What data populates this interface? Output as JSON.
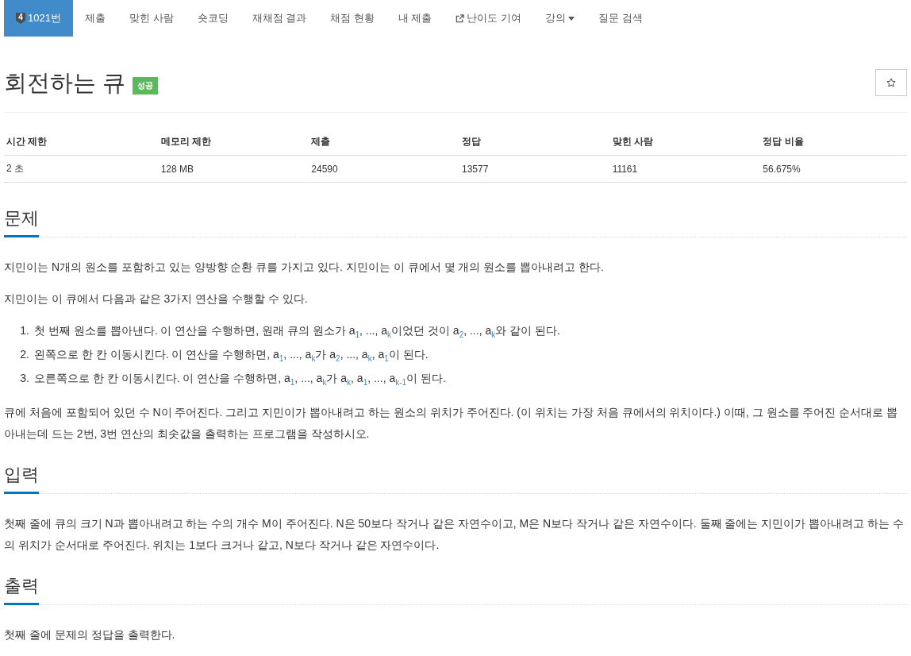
{
  "nav": {
    "items": [
      {
        "label": "1021번",
        "badge": "4",
        "kind": "problem",
        "selected": true
      },
      {
        "label": "제출",
        "kind": "link",
        "selected": false
      },
      {
        "label": "맞힌 사람",
        "kind": "link",
        "selected": false
      },
      {
        "label": "숏코딩",
        "kind": "link",
        "selected": false
      },
      {
        "label": "재채점 결과",
        "kind": "link",
        "selected": false
      },
      {
        "label": "채점 현황",
        "kind": "link",
        "selected": false
      },
      {
        "label": "내 제출",
        "kind": "link",
        "selected": false
      },
      {
        "label": "난이도 기여",
        "kind": "external",
        "selected": false
      },
      {
        "label": "강의",
        "kind": "dropdown",
        "selected": false
      },
      {
        "label": "질문 검색",
        "kind": "link",
        "selected": false
      }
    ]
  },
  "problem": {
    "title": "회전하는 큐",
    "status": "성공",
    "starred": false
  },
  "stats": {
    "columns": [
      "시간 제한",
      "메모리 제한",
      "제출",
      "정답",
      "맞힌 사람",
      "정답 비율"
    ],
    "rows": [
      [
        "2 초",
        "128 MB",
        "24590",
        "13577",
        "11161",
        "56.675%"
      ]
    ]
  },
  "sections": [
    {
      "heading": "문제",
      "blocks": [
        {
          "kind": "paragraph",
          "text": "지민이는 N개의 원소를 포함하고 있는 양방향 순환 큐를 가지고 있다. 지민이는 이 큐에서 몇 개의 원소를 뽑아내려고 한다."
        },
        {
          "kind": "paragraph",
          "text": "지민이는 이 큐에서 다음과 같은 3가지 연산을 수행할 수 있다."
        },
        {
          "kind": "ordered_list",
          "items": [
            {
              "number": "1.",
              "text": "첫 번째 원소를 뽑아낸다. 이 연산을 수행하면, 원래 큐의 원소가 a$_{1}$, ..., a$_{k}$이었던 것이 a$_{2}$, ..., a$_{k}$와 같이 된다."
            },
            {
              "number": "2.",
              "text": "왼쪽으로 한 칸 이동시킨다. 이 연산을 수행하면, a$_{1}$, ..., a$_{k}$가 a$_{2}$, ..., a$_{k}$, a$_{1}$이 된다."
            },
            {
              "number": "3.",
              "text": "오른쪽으로 한 칸 이동시킨다. 이 연산을 수행하면, a$_{1}$, ..., a$_{k}$가 a$_{k}$, a$_{1}$, ..., a$_{k-1}$이 된다."
            }
          ]
        },
        {
          "kind": "paragraph",
          "text": "큐에 처음에 포함되어 있던 수 N이 주어진다. 그리고 지민이가 뽑아내려고 하는 원소의 위치가 주어진다. (이 위치는 가장 처음 큐에서의 위치이다.) 이때, 그 원소를 주어진 순서대로 뽑아내는데 드는 2번, 3번 연산의 최솟값을 출력하는 프로그램을 작성하시오."
        }
      ]
    },
    {
      "heading": "입력",
      "blocks": [
        {
          "kind": "paragraph",
          "text": "첫째 줄에 큐의 크기 N과 뽑아내려고 하는 수의 개수 M이 주어진다. N은 50보다 작거나 같은 자연수이고, M은 N보다 작거나 같은 자연수이다. 둘째 줄에는 지민이가 뽑아내려고 하는 수의 위치가 순서대로 주어진다. 위치는 1보다 크거나 같고, N보다 작거나 같은 자연수이다."
        }
      ]
    },
    {
      "heading": "출력",
      "blocks": [
        {
          "kind": "paragraph",
          "text": "첫째 줄에 문제의 정답을 출력한다."
        }
      ]
    }
  ]
}
